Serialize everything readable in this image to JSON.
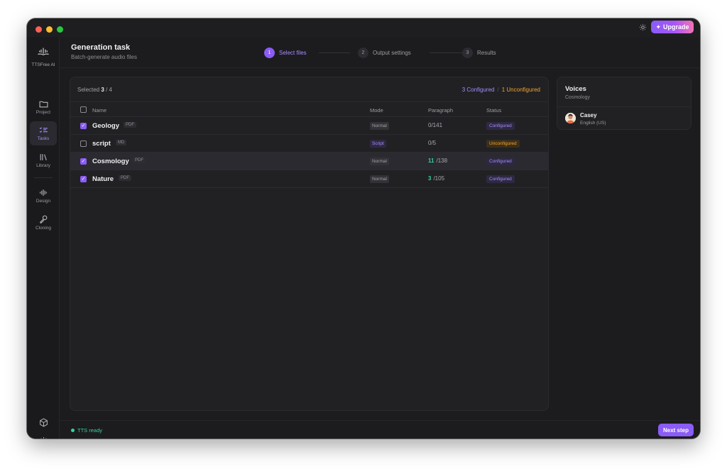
{
  "app": {
    "name": "TTSFree AI",
    "upgrade_label": "Upgrade"
  },
  "sidebar": {
    "items": [
      {
        "label": "Project",
        "icon": "folder-icon"
      },
      {
        "label": "Tasks",
        "icon": "tasks-icon",
        "active": true
      },
      {
        "label": "Library",
        "icon": "library-icon"
      },
      {
        "label": "Design",
        "icon": "waveform-icon"
      },
      {
        "label": "Cloning",
        "icon": "microphone-icon"
      }
    ],
    "bottom_icons": [
      "cube-icon",
      "gear-icon"
    ]
  },
  "header": {
    "title": "Generation task",
    "subtitle": "Batch-generate audio files",
    "steps": [
      {
        "num": "1",
        "label": "Select files",
        "active": true
      },
      {
        "num": "2",
        "label": "Output settings",
        "active": false
      },
      {
        "num": "3",
        "label": "Results",
        "active": false
      }
    ]
  },
  "files": {
    "selected_label": "Selected",
    "selected_count": "3",
    "total_label": "/ 4",
    "configured_label": "3 Configured",
    "separator": "/",
    "unconfigured_label": "1 Unconfigured",
    "columns": [
      "Name",
      "Mode",
      "Paragraph",
      "Status"
    ],
    "rows": [
      {
        "name": "Geology",
        "type": "PDF",
        "mode": "Normal",
        "para_done": "",
        "para_total": "0/141",
        "status": "Configured",
        "checked": true
      },
      {
        "name": "script",
        "type": "MD",
        "mode": "Script",
        "para_done": "",
        "para_total": "0/5",
        "status": "Unconfigured",
        "checked": false
      },
      {
        "name": "Cosmology",
        "type": "PDF",
        "mode": "Normal",
        "para_done": "11",
        "para_total": "/138",
        "status": "Configured",
        "checked": true
      },
      {
        "name": "Nature",
        "type": "PDF",
        "mode": "Normal",
        "para_done": "3",
        "para_total": "/105",
        "status": "Configured",
        "checked": true
      }
    ]
  },
  "voices": {
    "title": "Voices",
    "subtitle": "Cosmology",
    "items": [
      {
        "name": "Casey",
        "language": "English (US)"
      }
    ]
  },
  "footer": {
    "status": "TTS ready",
    "next_label": "Next step"
  },
  "colors": {
    "accent": "#8b5cf6",
    "configured": "#a78bfa",
    "unconfigured": "#f5a524",
    "success": "#34d399"
  }
}
